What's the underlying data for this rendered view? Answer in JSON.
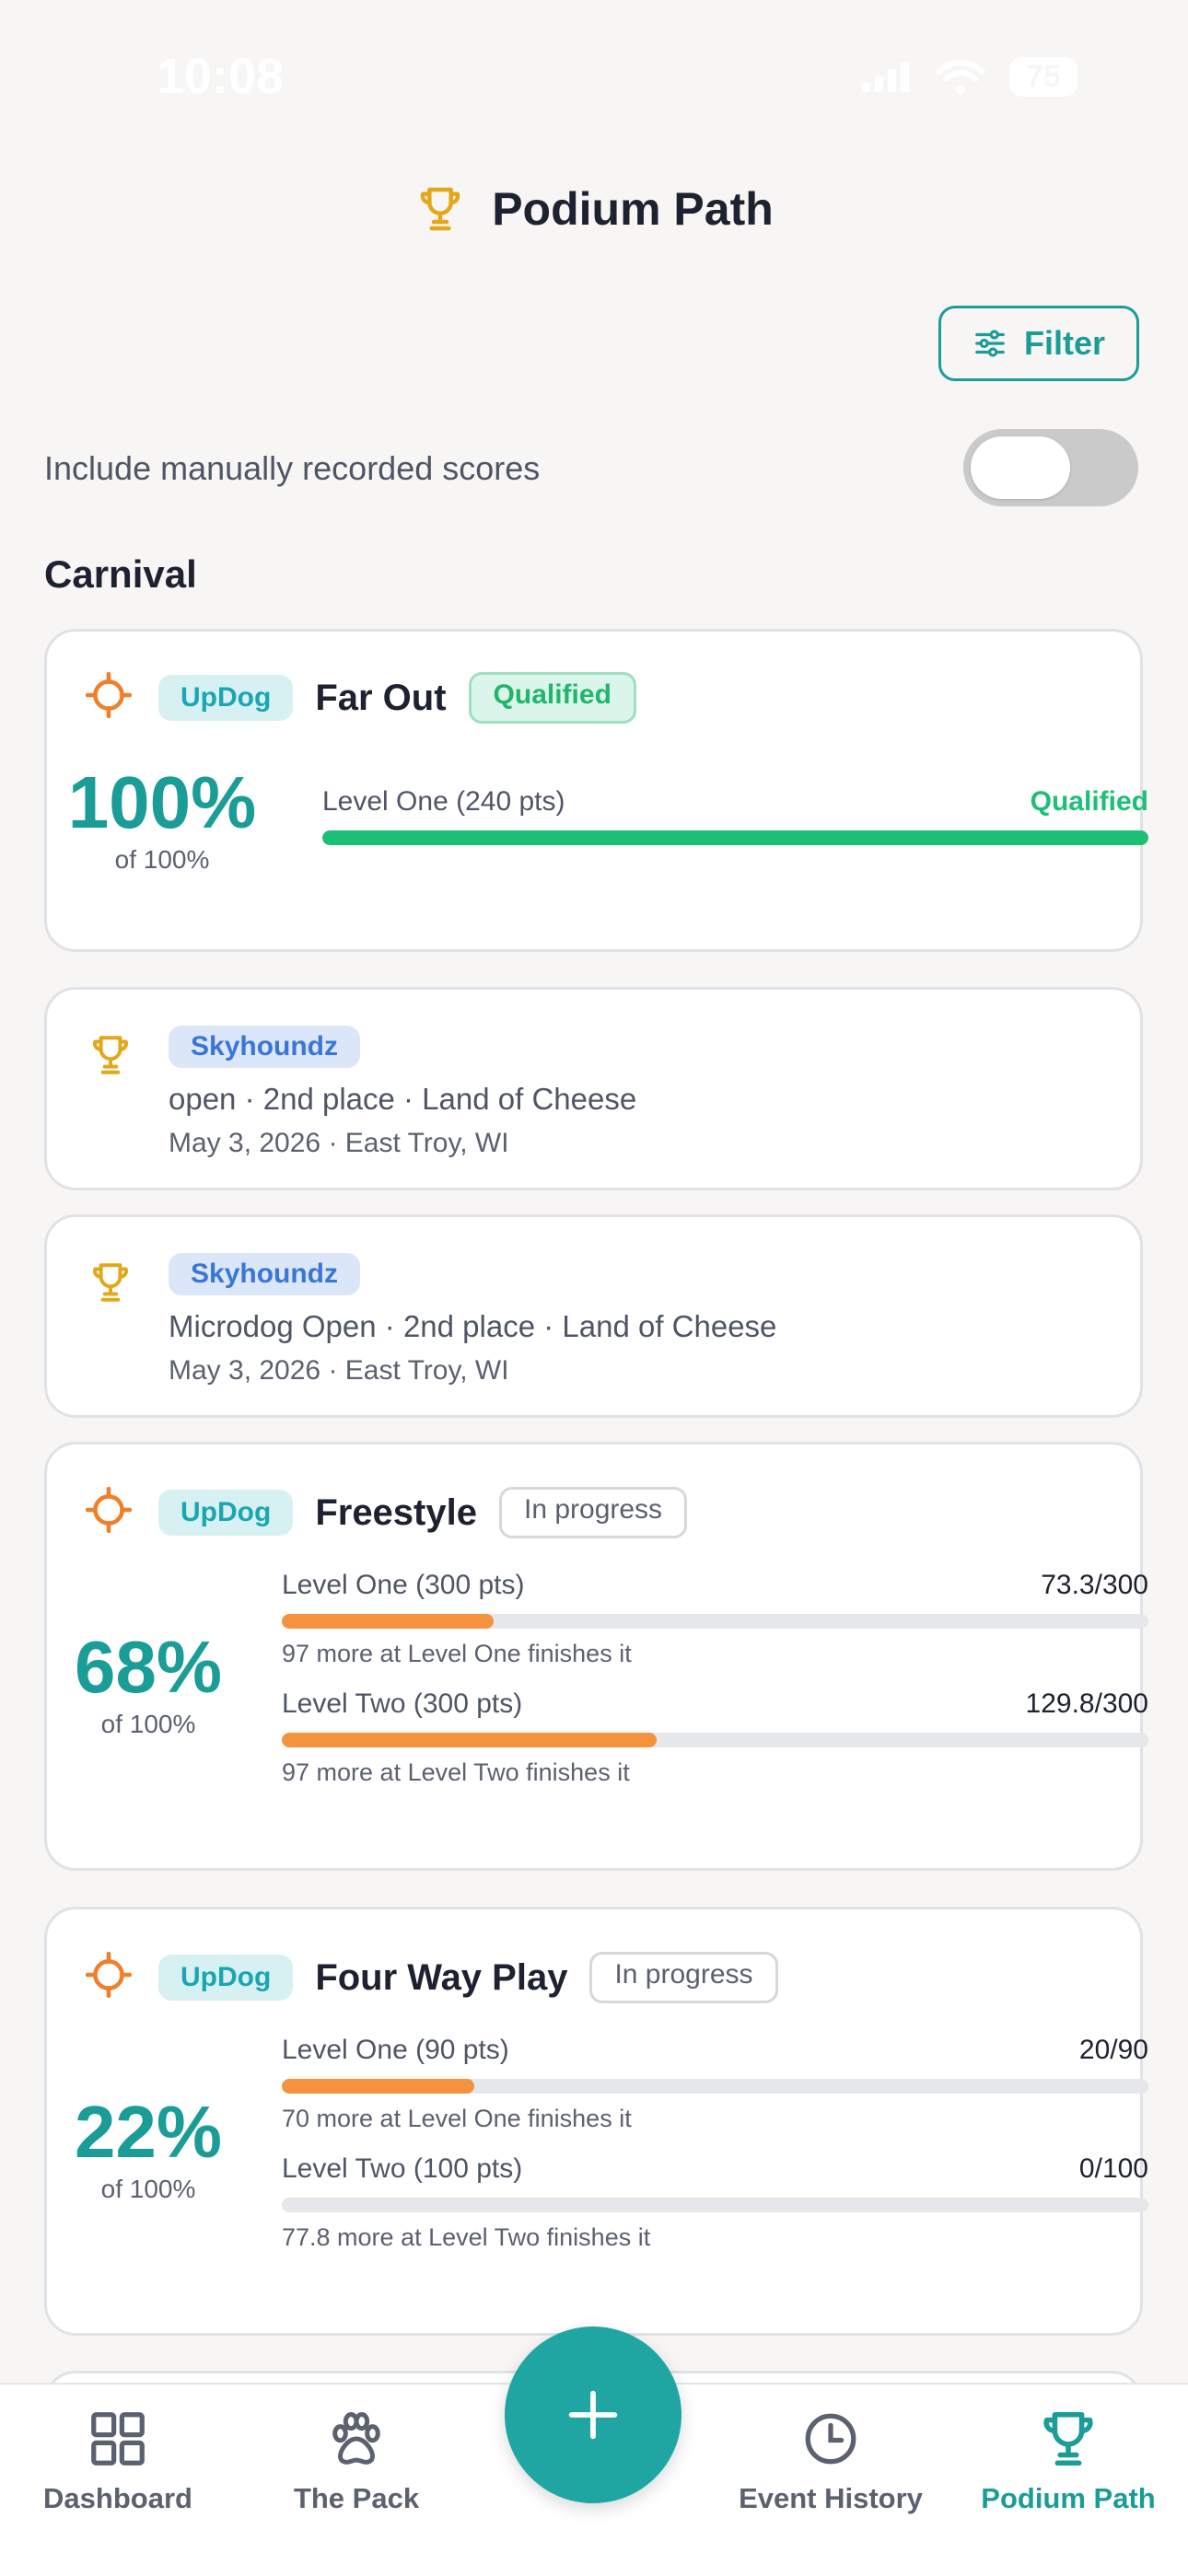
{
  "status_bar": {
    "time": "10:08",
    "battery": "75"
  },
  "header": {
    "title": "Podium Path",
    "filter_label": "Filter"
  },
  "toggle": {
    "label": "Include manually recorded scores",
    "on": false
  },
  "section": {
    "title": "Carnival"
  },
  "cards": [
    {
      "org": "UpDog",
      "event": "Far Out",
      "status": "Qualified",
      "percent": "100%",
      "percent_of": "of 100%",
      "levels": [
        {
          "label": "Level One (240 pts)",
          "value": "Qualified",
          "progress": 1.0
        }
      ]
    },
    {
      "org": "Skyhoundz",
      "line1": "open · 2nd place · Land of Cheese",
      "line2": "May 3, 2026 · East Troy, WI"
    },
    {
      "org": "Skyhoundz",
      "line1": "Microdog Open · 2nd place · Land of Cheese",
      "line2": "May 3, 2026 · East Troy, WI"
    },
    {
      "org": "UpDog",
      "event": "Freestyle",
      "status": "In progress",
      "percent": "68%",
      "percent_of": "of 100%",
      "levels": [
        {
          "label": "Level One (300 pts)",
          "value": "73.3/300",
          "hint": "97 more at Level One finishes it",
          "progress": 0.244
        },
        {
          "label": "Level Two (300 pts)",
          "value": "129.8/300",
          "hint": "97 more at Level Two finishes it",
          "progress": 0.433
        }
      ]
    },
    {
      "org": "UpDog",
      "event": "Four Way Play",
      "status": "In progress",
      "percent": "22%",
      "percent_of": "of 100%",
      "levels": [
        {
          "label": "Level One (90 pts)",
          "value": "20/90",
          "hint": "70 more at Level One finishes it",
          "progress": 0.222
        },
        {
          "label": "Level Two (100 pts)",
          "value": "0/100",
          "hint": "77.8 more at Level Two finishes it",
          "progress": 0.0
        }
      ]
    }
  ],
  "bottom_nav": {
    "items": [
      {
        "label": "Dashboard",
        "icon": "grid-icon"
      },
      {
        "label": "The Pack",
        "icon": "paw-icon"
      },
      {
        "label": "Event History",
        "icon": "clock-icon"
      },
      {
        "label": "Podium Path",
        "icon": "trophy-icon",
        "active": true
      }
    ],
    "fab_icon": "plus-icon"
  },
  "colors": {
    "accent": "#1a9c97",
    "qualified": "#1dbf77",
    "progress": "#f5923e",
    "target_icon": "#f07f2a",
    "trophy": "#e3a81a"
  }
}
